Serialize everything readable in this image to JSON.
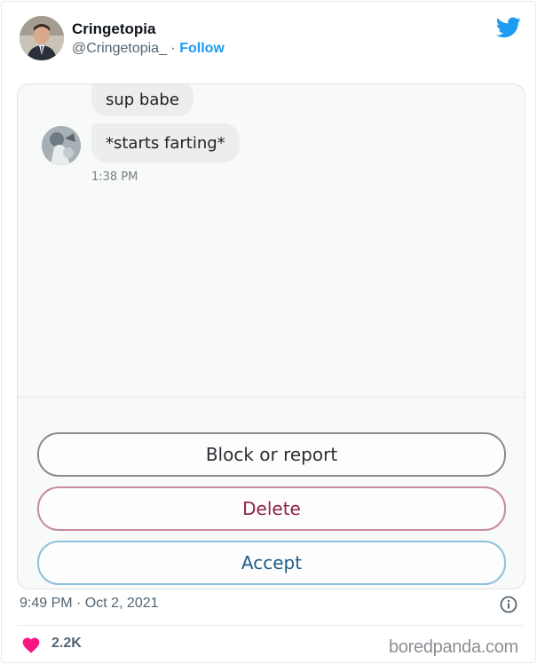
{
  "author": {
    "name": "Cringetopia",
    "handle": "@Cringetopia_",
    "separator": "·",
    "follow_label": "Follow"
  },
  "icons": {
    "brand": "twitter-bird-icon",
    "info": "info-icon",
    "like": "heart-icon"
  },
  "conversation": {
    "messages": [
      {
        "text": "sup babe"
      },
      {
        "text": "*starts farting*"
      }
    ],
    "timestamp": "1:38 PM"
  },
  "request_actions": {
    "block_label": "Block or report",
    "delete_label": "Delete",
    "accept_label": "Accept"
  },
  "tweet": {
    "timestamp": "9:49 PM · Oct 2, 2021",
    "likes": "2.2K"
  },
  "watermark": "boredpanda.com",
  "colors": {
    "brand_blue": "#1d9bf0",
    "like_red": "#f91880",
    "delete_border": "#c98aa3",
    "accept_border": "#8cc3dc"
  }
}
